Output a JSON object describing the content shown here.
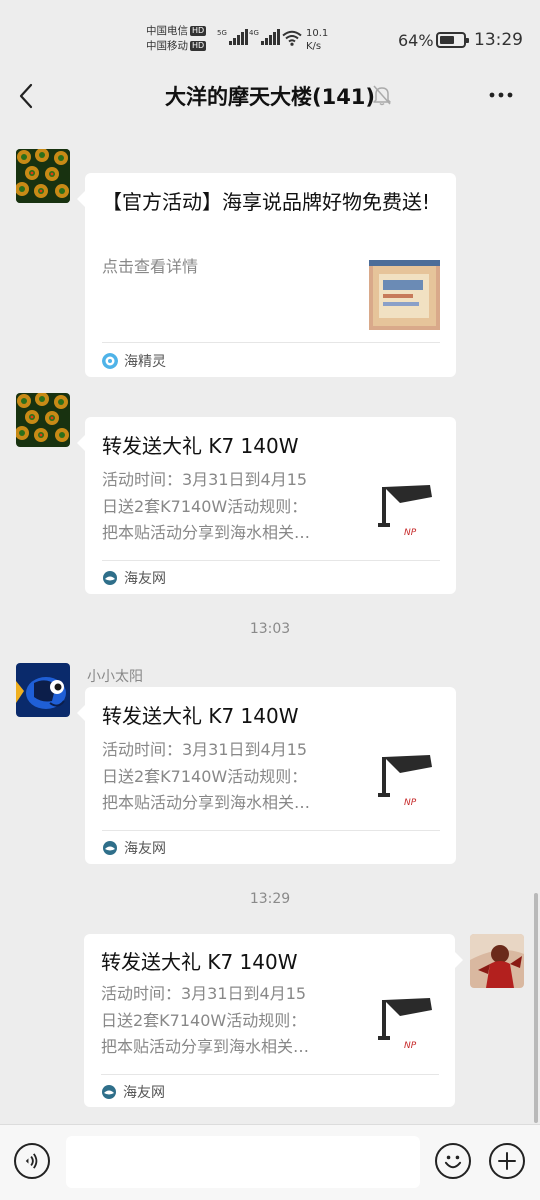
{
  "status_bar": {
    "carrier1": "中国电信",
    "carrier2": "中国移动",
    "hd1": "HD",
    "hd2": "HD",
    "sig1_tag": "5G",
    "sig2_tag": "4G",
    "speed_value": "10.1",
    "speed_unit": "K/s",
    "battery_percent": "64%",
    "battery_level": 0.64,
    "time": "13:29"
  },
  "header": {
    "title": "大洋的摩天大楼(141)",
    "back_icon": "chevron-left-icon",
    "mute_icon": "bell-off-icon",
    "more_icon": "more-dots-icon"
  },
  "messages": [
    {
      "side": "left",
      "title": "【官方活动】海享说品牌好物免费送!",
      "desc": "点击查看详情",
      "source": "海精灵"
    },
    {
      "side": "left",
      "title": "转发送大礼 K7 140W",
      "desc_lines": [
        "活动时间：3月31日到4月15",
        "日送2套K7140W活动规则：",
        "把本贴活动分享到海水相关…"
      ],
      "source": "海友网"
    },
    {
      "side": "left",
      "sender": "小小太阳",
      "title": "转发送大礼 K7 140W",
      "desc_lines": [
        "活动时间：3月31日到4月15",
        "日送2套K7140W活动规则：",
        "把本贴活动分享到海水相关…"
      ],
      "source": "海友网"
    },
    {
      "side": "right",
      "title": "转发送大礼 K7 140W",
      "desc_lines": [
        "活动时间：3月31日到4月15",
        "日送2套K7140W活动规则：",
        "把本贴活动分享到海水相关…"
      ],
      "source": "海友网"
    }
  ],
  "timestamps": [
    "13:03",
    "13:29"
  ],
  "input_bar": {
    "voice_icon": "voice-icon",
    "input_value": "",
    "emoji_icon": "emoji-icon",
    "plus_icon": "plus-icon"
  },
  "colors": {
    "background": "#ededed",
    "bubble": "#ffffff",
    "muted_text": "#888888",
    "thumb_brand_red": "#c62828"
  }
}
